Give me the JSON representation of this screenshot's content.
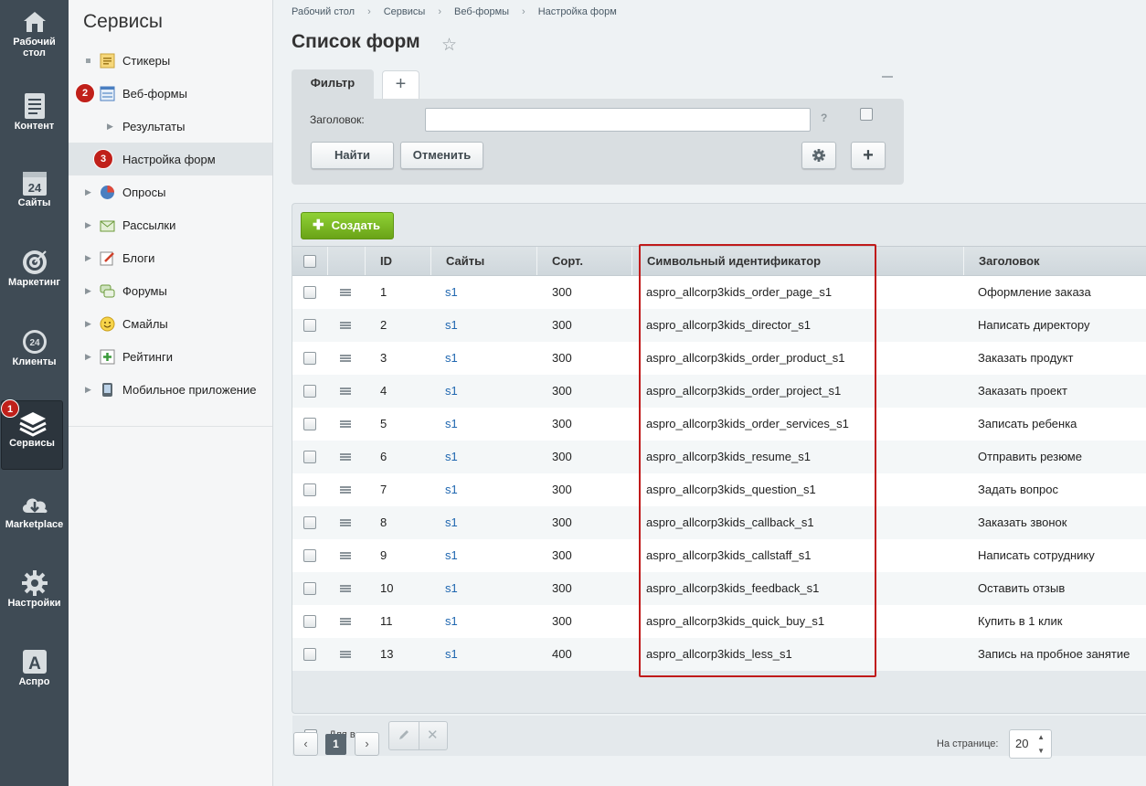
{
  "iconbar": {
    "items": [
      {
        "label": "Рабочий стол",
        "icon": "home-icon"
      },
      {
        "label": "Контент",
        "icon": "document-icon"
      },
      {
        "label": "Сайты",
        "icon": "calendar-24-icon"
      },
      {
        "label": "Маркетинг",
        "icon": "target-icon"
      },
      {
        "label": "Клиенты",
        "icon": "cloud-24-icon"
      },
      {
        "label": "Сервисы",
        "icon": "layers-icon"
      },
      {
        "label": "Marketplace",
        "icon": "cloud-download-icon"
      },
      {
        "label": "Настройки",
        "icon": "gear-icon"
      },
      {
        "label": "Аспро",
        "icon": "letter-a-icon"
      }
    ],
    "badge_services": "1"
  },
  "submenu": {
    "title": "Сервисы",
    "items": [
      {
        "label": "Стикеры",
        "icon": "sticker-icon"
      },
      {
        "label": "Веб-формы",
        "icon": "webform-icon",
        "badge": "2"
      },
      {
        "label": "Результаты"
      },
      {
        "label": "Настройка форм",
        "badge": "3"
      },
      {
        "label": "Опросы",
        "icon": "pie-icon"
      },
      {
        "label": "Рассылки",
        "icon": "envelope-icon"
      },
      {
        "label": "Блоги",
        "icon": "blog-icon"
      },
      {
        "label": "Форумы",
        "icon": "forum-icon"
      },
      {
        "label": "Смайлы",
        "icon": "smiley-icon"
      },
      {
        "label": "Рейтинги",
        "icon": "rating-icon"
      },
      {
        "label": "Мобильное приложение",
        "icon": "mobile-icon"
      }
    ]
  },
  "breadcrumb": [
    "Рабочий стол",
    "Сервисы",
    "Веб-формы",
    "Настройка форм"
  ],
  "page_title": "Список форм",
  "filter": {
    "tab_label": "Фильтр",
    "add_tab": "+",
    "field_label": "Заголовок:",
    "field_value": "",
    "help": "?",
    "find_label": "Найти",
    "cancel_label": "Отменить",
    "plus_label": "+"
  },
  "create_label": "Создать",
  "columns": {
    "id": "ID",
    "sites": "Сайты",
    "sort": "Сорт.",
    "code": "Символьный идентификатор",
    "title": "Заголовок"
  },
  "rows": [
    {
      "id": "1",
      "site": "s1",
      "sort": "300",
      "code": "aspro_allcorp3kids_order_page_s1",
      "title": "Оформление заказа"
    },
    {
      "id": "2",
      "site": "s1",
      "sort": "300",
      "code": "aspro_allcorp3kids_director_s1",
      "title": "Написать директору"
    },
    {
      "id": "3",
      "site": "s1",
      "sort": "300",
      "code": "aspro_allcorp3kids_order_product_s1",
      "title": "Заказать продукт"
    },
    {
      "id": "4",
      "site": "s1",
      "sort": "300",
      "code": "aspro_allcorp3kids_order_project_s1",
      "title": "Заказать проект"
    },
    {
      "id": "5",
      "site": "s1",
      "sort": "300",
      "code": "aspro_allcorp3kids_order_services_s1",
      "title": "Записать ребенка"
    },
    {
      "id": "6",
      "site": "s1",
      "sort": "300",
      "code": "aspro_allcorp3kids_resume_s1",
      "title": "Отправить резюме"
    },
    {
      "id": "7",
      "site": "s1",
      "sort": "300",
      "code": "aspro_allcorp3kids_question_s1",
      "title": "Задать вопрос"
    },
    {
      "id": "8",
      "site": "s1",
      "sort": "300",
      "code": "aspro_allcorp3kids_callback_s1",
      "title": "Заказать звонок"
    },
    {
      "id": "9",
      "site": "s1",
      "sort": "300",
      "code": "aspro_allcorp3kids_callstaff_s1",
      "title": "Написать сотруднику"
    },
    {
      "id": "10",
      "site": "s1",
      "sort": "300",
      "code": "aspro_allcorp3kids_feedback_s1",
      "title": "Оставить отзыв"
    },
    {
      "id": "11",
      "site": "s1",
      "sort": "300",
      "code": "aspro_allcorp3kids_quick_buy_s1",
      "title": "Купить в 1 клик"
    },
    {
      "id": "13",
      "site": "s1",
      "sort": "400",
      "code": "aspro_allcorp3kids_less_s1",
      "title": "Запись на пробное занятие"
    }
  ],
  "footer": {
    "for_all_label": "Для всех"
  },
  "pager": {
    "prev": "‹",
    "current": "1",
    "next": "›",
    "per_page_label": "На странице:",
    "per_page_value": "20"
  },
  "colors": {
    "accent_green": "#6aa317",
    "highlight_red": "#c01a1a",
    "link_blue": "#2067b0",
    "iconbar_bg": "#3f4b55"
  }
}
